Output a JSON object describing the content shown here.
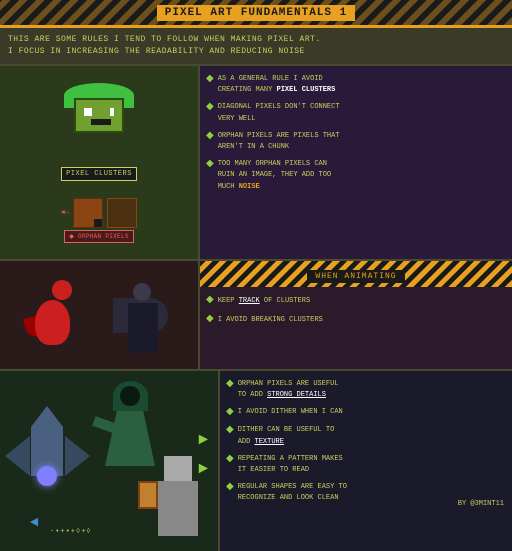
{
  "header": {
    "title": "PIXEL ART FUNDAMENTALS 1"
  },
  "intro": {
    "text": "THIS ARE SOME RULES I TEND TO FOLLOW WHEN MAKING PIXEL ART.\nI FOCUS IN INCREASING THE READABILITY AND REDUCING NOISE"
  },
  "section1": {
    "clusters_label": "PIXEL CLUSTERS",
    "orphan_label": "ORPHAN\nPIXELS",
    "bullets": [
      {
        "text": "AS A GENERAL RULE I AVOID\nCREATING MANY ",
        "highlight": "PIXEL CLUSTERS"
      },
      {
        "text": "DIAGONAL PIXELS DON'T CONNECT\nVERY WELL"
      },
      {
        "text": "ORPHAN PIXELS ARE PIXELS THAT\nAREN'T IN A CHUNK"
      },
      {
        "text": "TOO MANY ORPHAN PIXELS CAN\nRUIN AN IMAGE, THEY ADD TOO\nMUCH ",
        "highlight": "NOISE"
      }
    ]
  },
  "section2": {
    "header": "WHEN ANIMATING",
    "bullets": [
      {
        "text": "KEEP ",
        "highlight": "TRACK",
        "text2": " OF CLUSTERS"
      },
      {
        "text": "I AVOID BREAKING CLUSTERS"
      }
    ]
  },
  "section3": {
    "bullets": [
      {
        "text": "ORPHAN PIXELS ARE USEFUL\nTO ADD ",
        "highlight": "STRONG DETAILS"
      },
      {
        "text": "I AVOID DITHER WHEN I CAN"
      },
      {
        "text": "DITHER CAN BE USEFUL TO\nADD ",
        "highlight": "TEXTURE"
      },
      {
        "text": "REPEATING A PATTERN MAKES\nIT EASIER TO READ"
      },
      {
        "text": "REGULAR SHAPES ARE EASY TO\nRECOGNIZE AND LOOK CLEAN"
      }
    ]
  },
  "footer": {
    "credit": "BY @3MINT11"
  },
  "icons": {
    "bullet": "◆",
    "arrow_right": "►",
    "arrow_left": "◄"
  }
}
